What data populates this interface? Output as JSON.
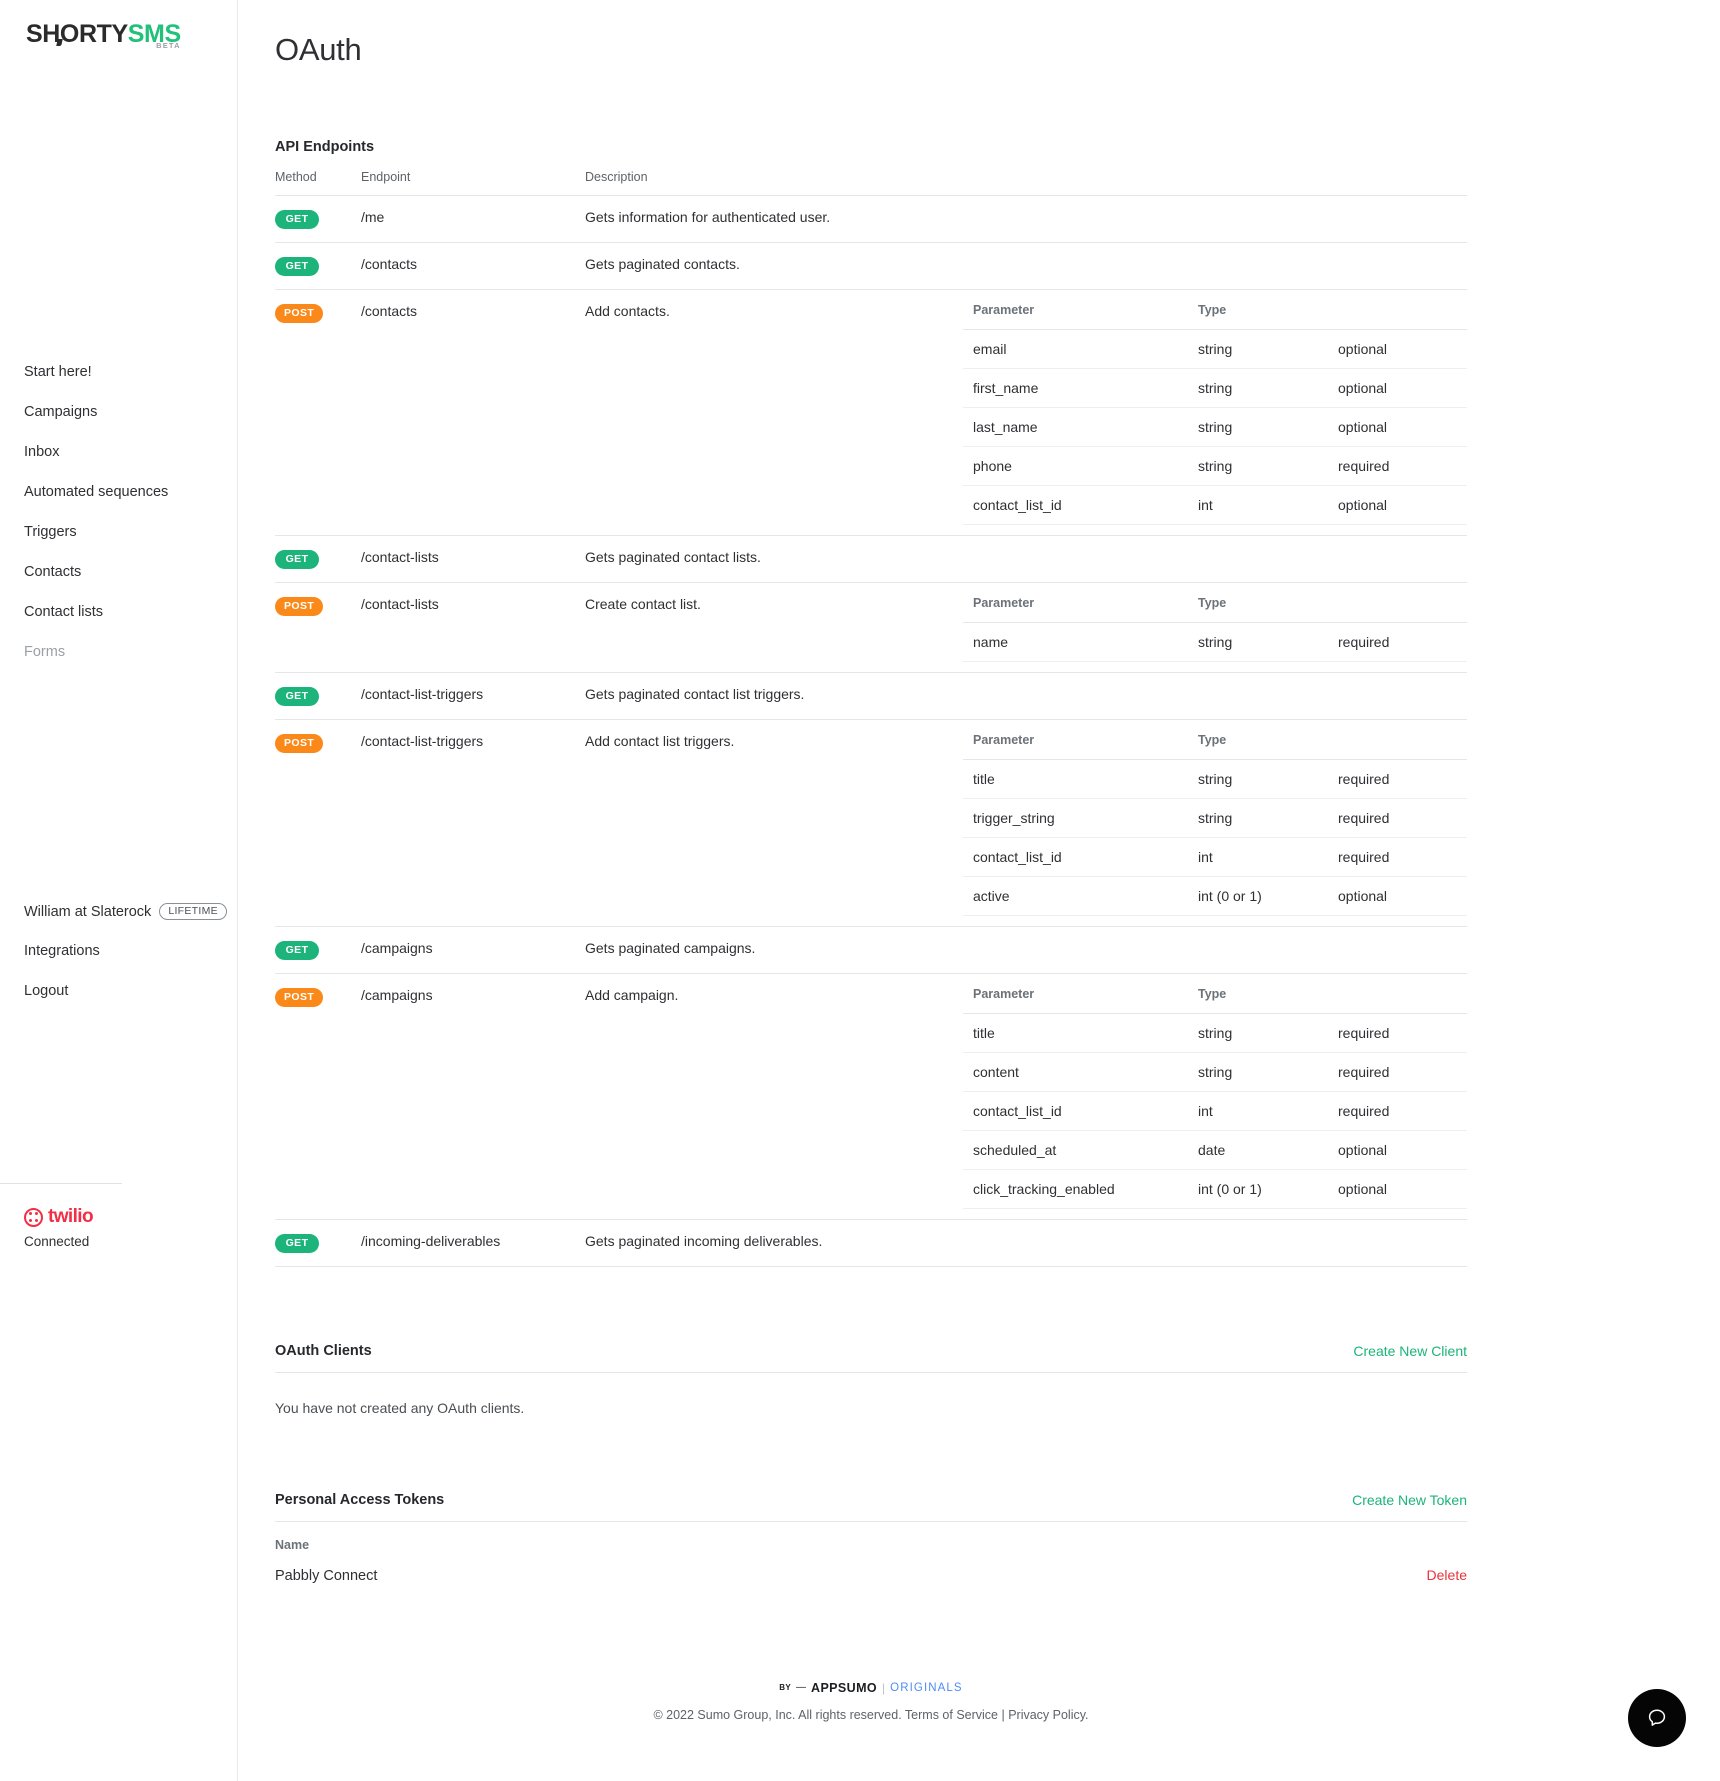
{
  "sidebar": {
    "logo": {
      "part1": "SHORTY",
      "part2": "SMS",
      "beta": "BETA"
    },
    "nav": [
      {
        "label": "Start here!",
        "muted": false
      },
      {
        "label": "Campaigns",
        "muted": false
      },
      {
        "label": "Inbox",
        "muted": false
      },
      {
        "label": "Automated sequences",
        "muted": false
      },
      {
        "label": "Triggers",
        "muted": false
      },
      {
        "label": "Contacts",
        "muted": false
      },
      {
        "label": "Contact lists",
        "muted": false
      },
      {
        "label": "Forms",
        "muted": true
      }
    ],
    "account": {
      "user_label": "William at Slaterock",
      "plan_badge": "LIFETIME",
      "integrations_label": "Integrations",
      "logout_label": "Logout"
    },
    "provider": {
      "name": "twilio",
      "status": "Connected",
      "brand_color": "#f22f46"
    }
  },
  "page": {
    "title": "OAuth"
  },
  "api": {
    "section_title": "API Endpoints",
    "columns": {
      "method": "Method",
      "endpoint": "Endpoint",
      "description": "Description"
    },
    "param_columns": {
      "parameter": "Parameter",
      "type": "Type"
    },
    "rows": [
      {
        "method": "GET",
        "endpoint": "/me",
        "description": "Gets information for authenticated user.",
        "params": []
      },
      {
        "method": "GET",
        "endpoint": "/contacts",
        "description": "Gets paginated contacts.",
        "params": []
      },
      {
        "method": "POST",
        "endpoint": "/contacts",
        "description": "Add contacts.",
        "params": [
          {
            "name": "email",
            "type": "string",
            "required": "optional"
          },
          {
            "name": "first_name",
            "type": "string",
            "required": "optional"
          },
          {
            "name": "last_name",
            "type": "string",
            "required": "optional"
          },
          {
            "name": "phone",
            "type": "string",
            "required": "required"
          },
          {
            "name": "contact_list_id",
            "type": "int",
            "required": "optional"
          }
        ]
      },
      {
        "method": "GET",
        "endpoint": "/contact-lists",
        "description": "Gets paginated contact lists.",
        "params": []
      },
      {
        "method": "POST",
        "endpoint": "/contact-lists",
        "description": "Create contact list.",
        "params": [
          {
            "name": "name",
            "type": "string",
            "required": "required"
          }
        ]
      },
      {
        "method": "GET",
        "endpoint": "/contact-list-triggers",
        "description": "Gets paginated contact list triggers.",
        "params": []
      },
      {
        "method": "POST",
        "endpoint": "/contact-list-triggers",
        "description": "Add contact list triggers.",
        "params": [
          {
            "name": "title",
            "type": "string",
            "required": "required"
          },
          {
            "name": "trigger_string",
            "type": "string",
            "required": "required"
          },
          {
            "name": "contact_list_id",
            "type": "int",
            "required": "required"
          },
          {
            "name": "active",
            "type": "int (0 or 1)",
            "required": "optional"
          }
        ]
      },
      {
        "method": "GET",
        "endpoint": "/campaigns",
        "description": "Gets paginated campaigns.",
        "params": []
      },
      {
        "method": "POST",
        "endpoint": "/campaigns",
        "description": "Add campaign.",
        "params": [
          {
            "name": "title",
            "type": "string",
            "required": "required"
          },
          {
            "name": "content",
            "type": "string",
            "required": "required"
          },
          {
            "name": "contact_list_id",
            "type": "int",
            "required": "required"
          },
          {
            "name": "scheduled_at",
            "type": "date",
            "required": "optional"
          },
          {
            "name": "click_tracking_enabled",
            "type": "int (0 or 1)",
            "required": "optional"
          }
        ]
      },
      {
        "method": "GET",
        "endpoint": "/incoming-deliverables",
        "description": "Gets paginated incoming deliverables.",
        "params": []
      }
    ]
  },
  "oauth_clients": {
    "title": "OAuth Clients",
    "action_label": "Create New Client",
    "empty_message": "You have not created any OAuth clients."
  },
  "tokens": {
    "title": "Personal Access Tokens",
    "action_label": "Create New Token",
    "column_name": "Name",
    "rows": [
      {
        "name": "Pabbly Connect",
        "action_label": "Delete"
      }
    ]
  },
  "footer": {
    "by": "BY",
    "dash": "—",
    "appsumo": "APPSUMO",
    "pipe": "|",
    "originals": "ORIGINALS",
    "legal": "© 2022 Sumo Group, Inc. All rights reserved. Terms of Service | Privacy Policy."
  },
  "colors": {
    "get_badge": "#1cb47a",
    "post_badge": "#fa8919",
    "link_green": "#1cb47a",
    "link_red": "#e8343c",
    "originals_blue": "#4e8df5"
  }
}
